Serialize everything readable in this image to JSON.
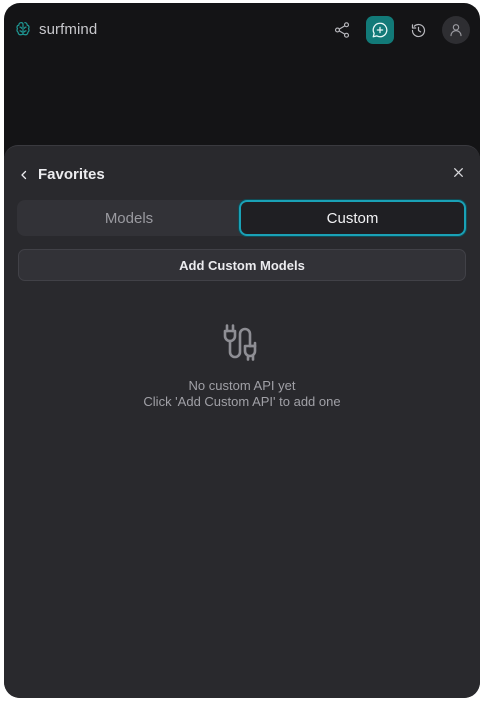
{
  "header": {
    "brand_name": "surfmind",
    "icons": {
      "brand": "brain-icon",
      "share": "share-icon",
      "new_chat": "new-chat-icon",
      "history": "history-icon",
      "avatar": "user-icon"
    },
    "accent_color": "#127a78"
  },
  "panel": {
    "title": "Favorites",
    "back_icon": "chevron-left-icon",
    "close_icon": "close-icon",
    "tabs": [
      {
        "label": "Models",
        "selected": false
      },
      {
        "label": "Custom",
        "selected": true
      }
    ],
    "add_button_label": "Add Custom Models",
    "empty_state": {
      "icon": "plug-icon",
      "line1": "No custom API yet",
      "line2": "Click 'Add Custom API' to add one"
    },
    "selected_tab_outline": "#1aa1b6"
  }
}
